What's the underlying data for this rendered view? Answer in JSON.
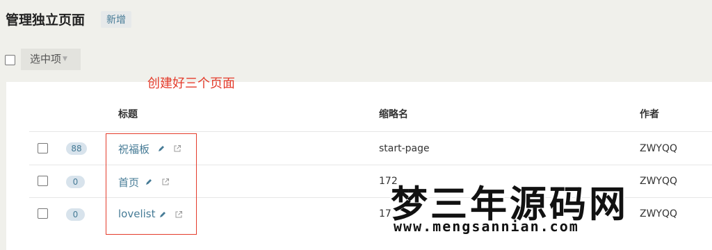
{
  "header": {
    "title": "管理独立页面",
    "add_label": "新增"
  },
  "toolbar": {
    "bulk_select_label": "选中项"
  },
  "annotation": {
    "text": "创建好三个页面",
    "color": "#e43b2b"
  },
  "table": {
    "columns": {
      "title": "标题",
      "slug": "缩略名",
      "author": "作者"
    },
    "rows": [
      {
        "count": "88",
        "title": "祝福板",
        "slug": "start-page",
        "author": "ZWYQQ"
      },
      {
        "count": "0",
        "title": "首页",
        "slug": "172",
        "author": "ZWYQQ"
      },
      {
        "count": "0",
        "title": "lovelist",
        "slug": "17",
        "author": "ZWYQQ"
      }
    ]
  },
  "icons": {
    "edit": "pencil-icon",
    "view": "external-link-icon"
  },
  "colors": {
    "link": "#467b96",
    "badge_bg": "#d8e3ec",
    "annotation": "#e43b2b"
  },
  "watermark": {
    "text": "梦三年源码网",
    "url": "www.mengsannian.com"
  }
}
